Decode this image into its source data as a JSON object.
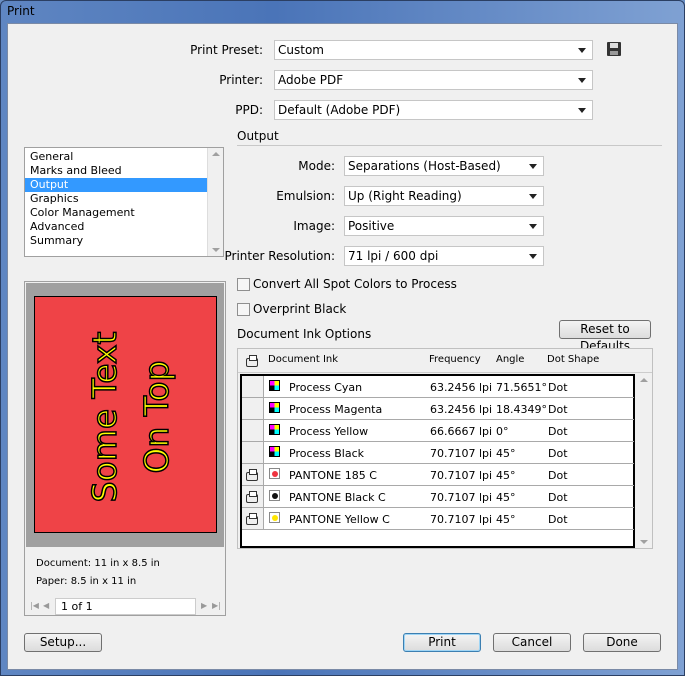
{
  "window": {
    "title": "Print"
  },
  "top": {
    "preset_label": "Print Preset:",
    "preset_value": "Custom",
    "printer_label": "Printer:",
    "printer_value": "Adobe PDF",
    "ppd_label": "PPD:",
    "ppd_value": "Default (Adobe PDF)",
    "save_icon": "floppy-disk-icon"
  },
  "sidebar": {
    "items": [
      {
        "label": "General"
      },
      {
        "label": "Marks and Bleed"
      },
      {
        "label": "Output",
        "selected": true
      },
      {
        "label": "Graphics"
      },
      {
        "label": "Color Management"
      },
      {
        "label": "Advanced"
      },
      {
        "label": "Summary"
      }
    ]
  },
  "preview": {
    "text_line1": "Some Text",
    "text_line2": "On Top",
    "page_color": "#ef4347",
    "text_color": "#ffff00",
    "document": "Document: 11 in x 8.5 in",
    "paper": "Paper: 8.5 in x 11 in",
    "page": "1 of 1"
  },
  "output": {
    "section": "Output",
    "mode_label": "Mode:",
    "mode_value": "Separations (Host-Based)",
    "emulsion_label": "Emulsion:",
    "emulsion_value": "Up (Right Reading)",
    "image_label": "Image:",
    "image_value": "Positive",
    "resolution_label": "Printer Resolution:",
    "resolution_value": "71 lpi / 600 dpi",
    "convert_spot": "Convert All Spot Colors to Process",
    "convert_spot_checked": false,
    "overprint_black": "Overprint Black",
    "overprint_black_checked": false,
    "ink_options": "Document Ink Options",
    "reset": "Reset to Defaults"
  },
  "inks": {
    "headers": {
      "ink": "Document Ink",
      "frequency": "Frequency",
      "angle": "Angle",
      "dot": "Dot Shape"
    },
    "rows": [
      {
        "name": "Process Cyan",
        "frequency": "63.2456 lpi",
        "angle": "71.5651°",
        "dot": "Dot",
        "print": false,
        "type": "process"
      },
      {
        "name": "Process Magenta",
        "frequency": "63.2456 lpi",
        "angle": "18.4349°",
        "dot": "Dot",
        "print": false,
        "type": "process"
      },
      {
        "name": "Process Yellow",
        "frequency": "66.6667 lpi",
        "angle": "0°",
        "dot": "Dot",
        "print": false,
        "type": "process"
      },
      {
        "name": "Process Black",
        "frequency": "70.7107 lpi",
        "angle": "45°",
        "dot": "Dot",
        "print": false,
        "type": "process"
      },
      {
        "name": "PANTONE 185 C",
        "frequency": "70.7107 lpi",
        "angle": "45°",
        "dot": "Dot",
        "print": true,
        "color": "#ef3340"
      },
      {
        "name": "PANTONE Black C",
        "frequency": "70.7107 lpi",
        "angle": "45°",
        "dot": "Dot",
        "print": true,
        "color": "#111111"
      },
      {
        "name": "PANTONE Yellow C",
        "frequency": "70.7107 lpi",
        "angle": "45°",
        "dot": "Dot",
        "print": true,
        "color": "#ffe600"
      }
    ]
  },
  "buttons": {
    "setup": "Setup...",
    "print": "Print",
    "cancel": "Cancel",
    "done": "Done"
  }
}
